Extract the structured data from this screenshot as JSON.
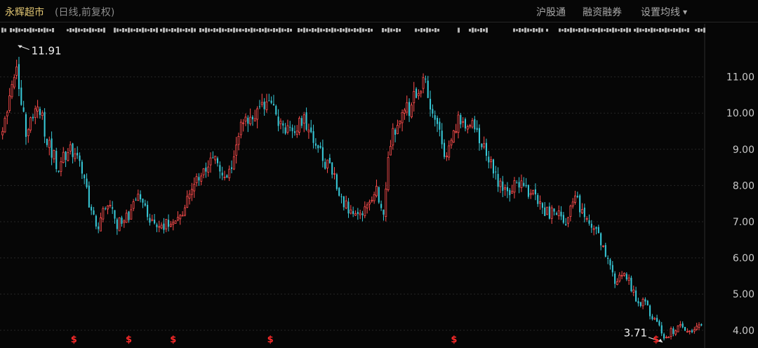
{
  "header": {
    "title": "永辉超市",
    "subtitle": "(日线,前复权)",
    "buttons": [
      "沪股通",
      "融资融券",
      "设置均线"
    ]
  },
  "colors": {
    "up": "#ff4d4d",
    "down": "#37c8d7",
    "grid": "#272727",
    "axis_text": "#c8c8c8",
    "marker": "#ff2a2a",
    "background": "#060606"
  },
  "chart_data": {
    "type": "candlestick",
    "period": "daily",
    "adjustment": "forward-adjusted",
    "ylim": [
      3.55,
      12.0
    ],
    "y_ticks": [
      "11.00",
      "10.00",
      "9.00",
      "8.00",
      "7.00",
      "6.00",
      "5.00",
      "4.00"
    ],
    "grid": true,
    "annotations": [
      {
        "label": "11.91",
        "kind": "max",
        "approx_index_fraction": 0.02
      },
      {
        "label": "3.71",
        "kind": "min",
        "approx_index_fraction": 0.947
      }
    ],
    "markers": [
      {
        "label": "$",
        "approx_index_fraction": 0.105
      },
      {
        "label": "$",
        "approx_index_fraction": 0.183
      },
      {
        "label": "$",
        "approx_index_fraction": 0.246
      },
      {
        "label": "$",
        "approx_index_fraction": 0.384
      },
      {
        "label": "$",
        "approx_index_fraction": 0.645
      },
      {
        "label": "$",
        "approx_index_fraction": 0.932
      }
    ],
    "candle_count": 300,
    "seed": 20231,
    "close_anchors": [
      [
        0.0,
        9.7
      ],
      [
        0.02,
        11.2
      ],
      [
        0.033,
        9.5
      ],
      [
        0.05,
        10.4
      ],
      [
        0.066,
        9.1
      ],
      [
        0.08,
        8.55
      ],
      [
        0.095,
        8.9
      ],
      [
        0.108,
        9.0
      ],
      [
        0.12,
        7.8
      ],
      [
        0.135,
        6.8
      ],
      [
        0.15,
        7.6
      ],
      [
        0.165,
        6.9
      ],
      [
        0.18,
        7.2
      ],
      [
        0.195,
        7.7
      ],
      [
        0.21,
        7.1
      ],
      [
        0.23,
        6.9
      ],
      [
        0.245,
        7.0
      ],
      [
        0.26,
        7.4
      ],
      [
        0.28,
        8.2
      ],
      [
        0.3,
        8.8
      ],
      [
        0.32,
        8.0
      ],
      [
        0.34,
        9.6
      ],
      [
        0.36,
        9.8
      ],
      [
        0.383,
        10.3
      ],
      [
        0.4,
        9.7
      ],
      [
        0.415,
        9.4
      ],
      [
        0.43,
        9.8
      ],
      [
        0.445,
        9.1
      ],
      [
        0.46,
        8.7
      ],
      [
        0.475,
        8.2
      ],
      [
        0.49,
        7.5
      ],
      [
        0.505,
        7.1
      ],
      [
        0.52,
        7.5
      ],
      [
        0.535,
        8.0
      ],
      [
        0.545,
        7.0
      ],
      [
        0.555,
        9.3
      ],
      [
        0.57,
        9.8
      ],
      [
        0.59,
        10.4
      ],
      [
        0.605,
        10.8
      ],
      [
        0.62,
        9.6
      ],
      [
        0.635,
        8.8
      ],
      [
        0.65,
        9.8
      ],
      [
        0.665,
        9.8
      ],
      [
        0.68,
        9.3
      ],
      [
        0.695,
        8.8
      ],
      [
        0.71,
        8.0
      ],
      [
        0.725,
        7.9
      ],
      [
        0.74,
        8.0
      ],
      [
        0.76,
        7.8
      ],
      [
        0.775,
        7.2
      ],
      [
        0.79,
        7.3
      ],
      [
        0.805,
        7.0
      ],
      [
        0.82,
        7.6
      ],
      [
        0.835,
        7.0
      ],
      [
        0.85,
        6.7
      ],
      [
        0.865,
        6.1
      ],
      [
        0.875,
        5.3
      ],
      [
        0.89,
        5.7
      ],
      [
        0.905,
        4.9
      ],
      [
        0.92,
        4.7
      ],
      [
        0.935,
        4.2
      ],
      [
        0.947,
        3.8
      ],
      [
        0.96,
        4.0
      ],
      [
        0.975,
        4.1
      ],
      [
        0.99,
        4.0
      ],
      [
        1.0,
        4.2
      ]
    ]
  }
}
